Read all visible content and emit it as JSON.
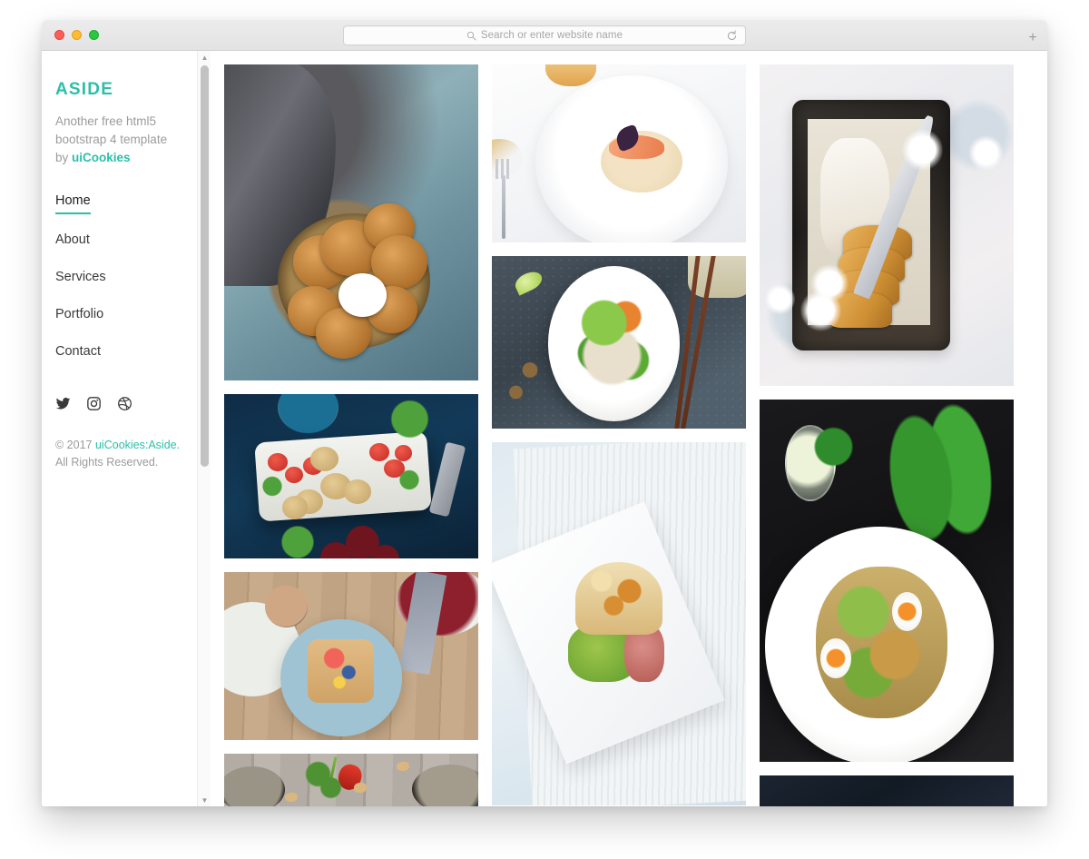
{
  "browser": {
    "window_controls": [
      "close",
      "minimize",
      "zoom"
    ],
    "address_placeholder": "Search or enter website name",
    "address_value": "",
    "search_icon": "search-icon",
    "reload_icon": "reload-icon",
    "new_tab_label": "+"
  },
  "sidebar": {
    "brand": "ASIDE",
    "tagline_line1": "Another free html5",
    "tagline_line2": "bootstrap 4 template",
    "tagline_by": "by",
    "tagline_accent": "uiCookies",
    "nav": [
      {
        "label": "Home",
        "active": true
      },
      {
        "label": "About",
        "active": false
      },
      {
        "label": "Services",
        "active": false
      },
      {
        "label": "Portfolio",
        "active": false
      },
      {
        "label": "Contact",
        "active": false
      }
    ],
    "socials": [
      {
        "name": "twitter-icon"
      },
      {
        "name": "instagram-icon"
      },
      {
        "name": "dribbble-icon"
      }
    ],
    "copyright_prefix": "© 2017",
    "copyright_accent": "uiCookies:Aside.",
    "copyright_suffix": "All Rights Reserved.",
    "accent_color": "#2bbfa8",
    "scrollbar": {
      "visible": true,
      "position": "right"
    }
  },
  "gallery": {
    "columns": [
      {
        "items": [
          {
            "alt": "Cookies on a brass plate with cream bowl on blue textured surface"
          },
          {
            "alt": "Cheese and berry board with crackers on deep blue table"
          },
          {
            "alt": "Breakfast waffles with berries and coffee on wooden table"
          },
          {
            "alt": "Bowls with cilantro, red chili and cashews on grey wood"
          }
        ]
      },
      {
        "items": [
          {
            "alt": "Shrimp dish on white textured plate with fork"
          },
          {
            "alt": "Noodle salad bowl with chopsticks and star anise"
          },
          {
            "alt": "Burger with tiger bread bun on white rectangular plate"
          }
        ]
      },
      {
        "items": [
          {
            "alt": "Christmas stollen on a dark baking tray with knife"
          },
          {
            "alt": "Caesar salad with chicken and soft eggs on white plate"
          },
          {
            "alt": "Dark moody food photograph"
          }
        ]
      }
    ]
  }
}
